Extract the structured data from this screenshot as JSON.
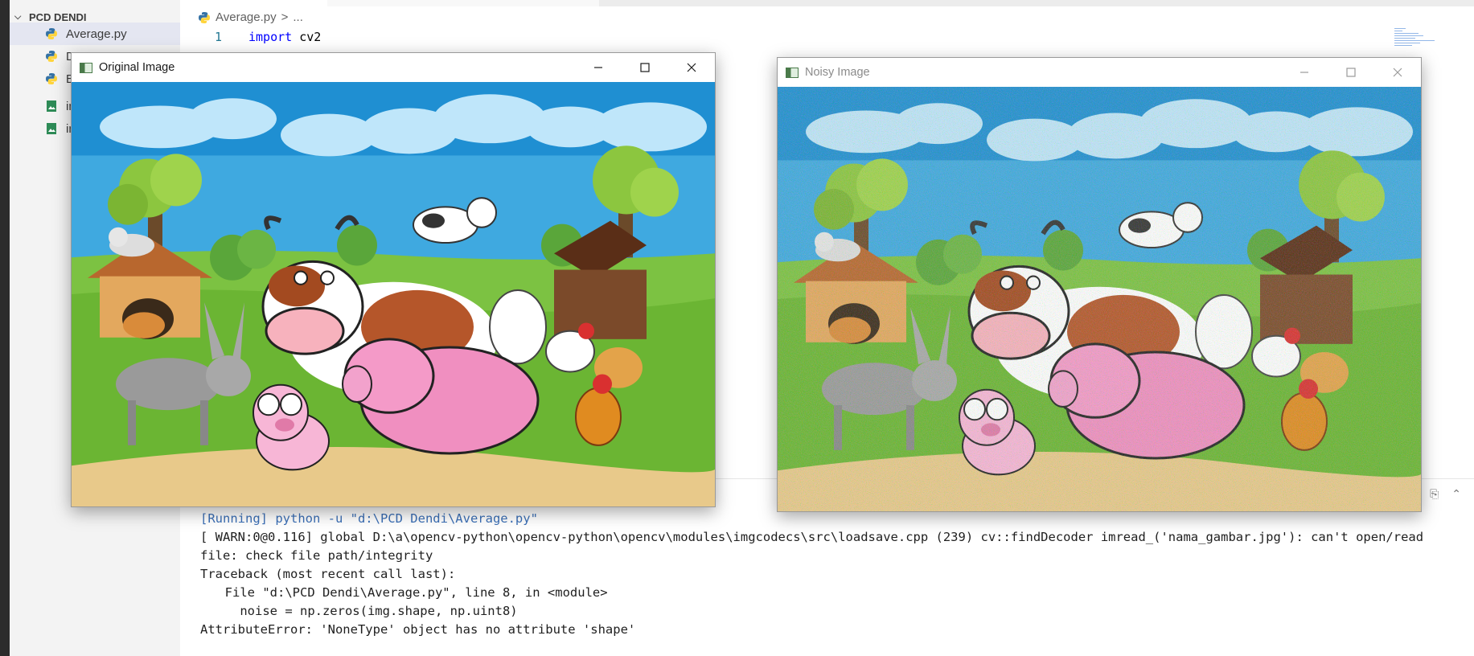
{
  "explorer": {
    "header": "PCD DENDI",
    "items": [
      {
        "label": "Average.py",
        "icon": "python-file-icon",
        "active": true
      },
      {
        "label": "D",
        "icon": "python-file-icon",
        "active": false
      },
      {
        "label": "E",
        "icon": "python-file-icon",
        "active": false
      },
      {
        "label": "im",
        "icon": "image-file-icon",
        "active": false
      },
      {
        "label": "im",
        "icon": "image-file-icon",
        "active": false
      }
    ]
  },
  "editor": {
    "breadcrumb": {
      "file": "Average.py",
      "separator": ">",
      "rest": "..."
    },
    "line_number": "1",
    "code_keyword": "import",
    "code_rest": " cv2"
  },
  "terminal": {
    "lines": [
      "[Running] python -u \"d:\\PCD Dendi\\Average.py\"",
      "[ WARN:0@0.116] global D:\\a\\opencv-python\\opencv-python\\opencv\\modules\\imgcodecs\\src\\loadsave.cpp (239) cv::findDecoder imread_('nama_gambar.jpg'): can't open/read",
      "file: check file path/integrity",
      "Traceback (most recent call last):",
      "  File \"d:\\PCD Dendi\\Average.py\", line 8, in <module>",
      "    noise = np.zeros(img.shape, np.uint8)",
      "AttributeError: 'NoneType' object has no attribute 'shape'"
    ]
  },
  "windows": {
    "original": {
      "title": "Original Image",
      "controls": [
        "minimize-icon",
        "maximize-icon",
        "close-icon"
      ]
    },
    "noisy": {
      "title": "Noisy Image",
      "controls": [
        "minimize-icon",
        "maximize-icon",
        "close-icon"
      ]
    }
  },
  "colors": {
    "sky": "#3fa9e0",
    "grass": "#7cc242",
    "ground": "#e8c98a",
    "pig": "#f08fc0",
    "barn": "#7b4a2a",
    "accent": "#0078d4"
  }
}
